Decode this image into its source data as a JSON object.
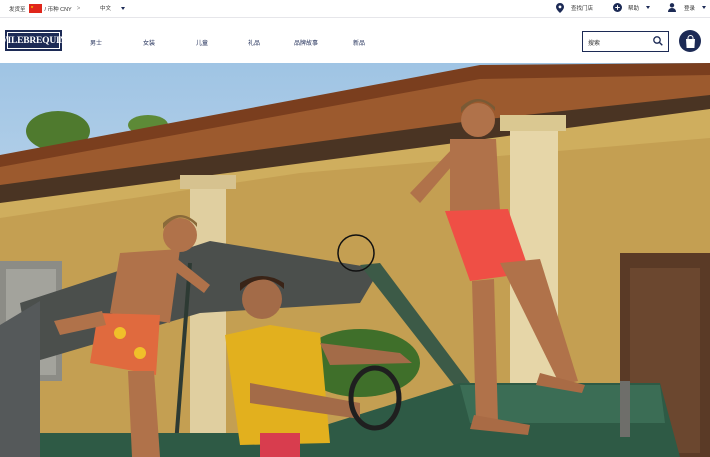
{
  "topbar": {
    "region_label": "发货至",
    "currency_label": "/ 币种 CNY",
    "region_chevron": ">",
    "language": "中文",
    "store_locator": "查找门店",
    "help": "帮助",
    "login": "登录"
  },
  "header": {
    "logo": "VILEBREQUIN",
    "nav": [
      "男士",
      "女装",
      "儿童",
      "礼品",
      "品牌故事",
      "新品"
    ],
    "search_placeholder": "搜索"
  },
  "colors": {
    "brand": "#1c2a55",
    "flag": "#e0261b"
  }
}
